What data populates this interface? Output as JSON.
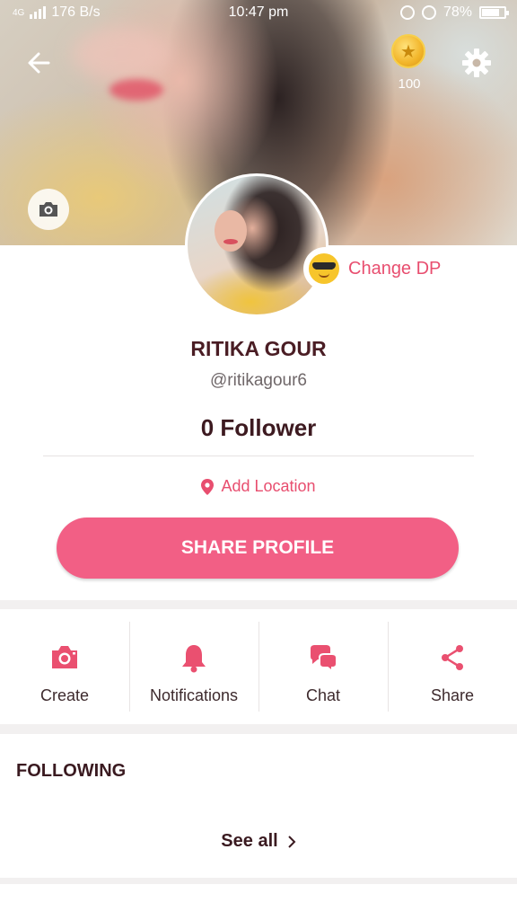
{
  "status_bar": {
    "network": "4G",
    "speed": "176 B/s",
    "time": "10:47 pm",
    "battery": "78%",
    "battery_level": 0.78
  },
  "header": {
    "coins": "100"
  },
  "profile": {
    "change_dp_label": "Change DP",
    "name": "RITIKA GOUR",
    "handle": "@ritikagour6",
    "followers": "0 Follower",
    "add_location": "Add Location",
    "share_profile": "SHARE PROFILE"
  },
  "actions": [
    {
      "label": "Create",
      "icon": "camera-icon"
    },
    {
      "label": "Notifications",
      "icon": "bell-icon"
    },
    {
      "label": "Chat",
      "icon": "chat-bubbles-icon"
    },
    {
      "label": "Share",
      "icon": "share-icon"
    }
  ],
  "following": {
    "title": "FOLLOWING",
    "see_all": "See all"
  },
  "colors": {
    "accent": "#f25f85",
    "accent_text": "#e84e6f",
    "name_text": "#4a1d24"
  }
}
